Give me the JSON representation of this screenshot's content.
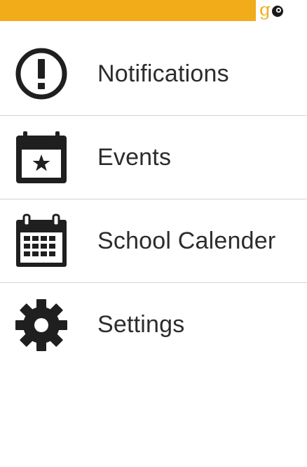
{
  "colors": {
    "accent": "#F2AC1A",
    "icon": "#1f1f1f",
    "divider": "#d4d4d4"
  },
  "header": {
    "logo_letter": "g",
    "logo_name": "go"
  },
  "menu": {
    "items": [
      {
        "label": "Notifications",
        "icon": "exclamation-circle-icon"
      },
      {
        "label": "Events",
        "icon": "calendar-star-icon"
      },
      {
        "label": "School Calender",
        "icon": "calendar-grid-icon"
      },
      {
        "label": "Settings",
        "icon": "gear-icon"
      }
    ]
  }
}
